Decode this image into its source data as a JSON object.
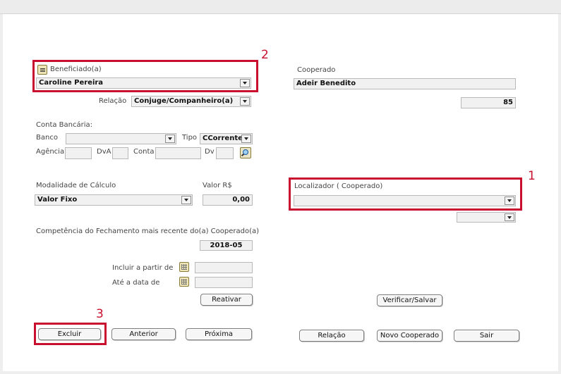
{
  "beneficiado": {
    "label": "Beneficiado(a)",
    "value": "Caroline Pereira",
    "icon": "list-icon"
  },
  "relacao": {
    "label": "Relação",
    "value": "Conjuge/Companheiro(a)"
  },
  "cooperado": {
    "label": "Cooperado",
    "name": "Adeir Benedito",
    "number": "85"
  },
  "conta": {
    "title": "Conta Bancária:",
    "banco_label": "Banco",
    "banco_value": "",
    "tipo_label": "Tipo",
    "tipo_value": "CCorrente",
    "agencia_label": "Agência",
    "dva_label": "DvA",
    "conta_label": "Conta",
    "dv_label": "Dv"
  },
  "modalidade": {
    "label": "Modalidade de Cálculo",
    "value": "Valor Fixo"
  },
  "valor": {
    "label": "Valor R$",
    "value": "0,00"
  },
  "localizador": {
    "label": "Localizador ( Cooperado)",
    "value": "",
    "secondary_value": ""
  },
  "competencia": {
    "label": "Competência do Fechamento mais recente do(a) Cooperado(a)",
    "value": "2018-05"
  },
  "datas": {
    "incluir_label": "Incluir a partir de",
    "ate_label": "Até a data de",
    "incluir_value": "",
    "ate_value": ""
  },
  "buttons": {
    "reativar": "Reativar",
    "verificar": "Verificar/Salvar",
    "excluir": "Excluir",
    "anterior": "Anterior",
    "proxima": "Próxima",
    "relacao": "Relação",
    "novo_cooperado": "Novo Cooperado",
    "sair": "Sair"
  },
  "markers": {
    "one": "1",
    "two": "2",
    "three": "3"
  },
  "colors": {
    "highlight": "#c8102e",
    "field_bg": "#f1f1f1"
  }
}
